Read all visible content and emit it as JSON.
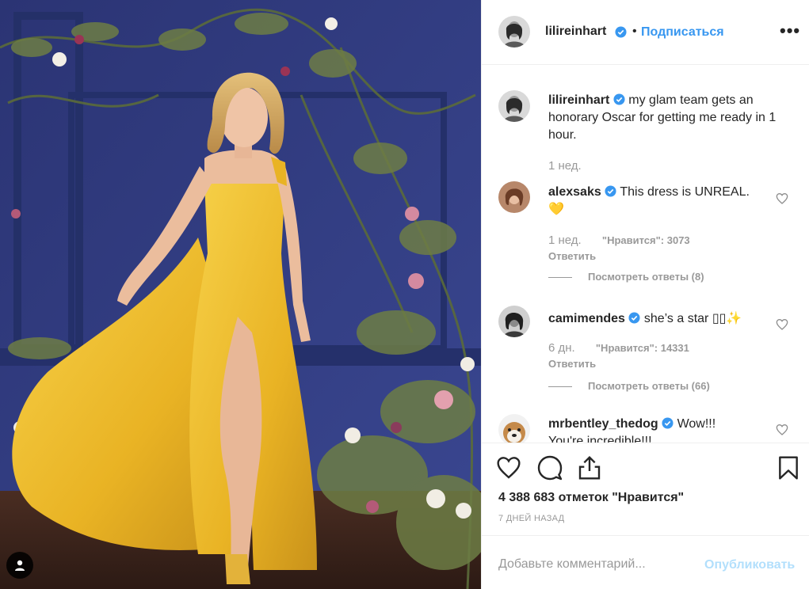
{
  "post": {
    "author": "lilireinhart",
    "follow_label": "Подписаться",
    "dot": "•",
    "more_label": "•••",
    "caption": {
      "username": "lilireinhart",
      "text": "my glam team gets an honorary Oscar for getting me ready in 1 hour.",
      "time": "1 нед."
    },
    "comments": [
      {
        "username": "alexsaks",
        "text": "This dress is UNREAL.",
        "emoji": "💛",
        "time": "1 нед.",
        "likes": "\"Нравится\": 3073",
        "reply_label": "Ответить",
        "view_replies": "Посмотреть ответы (8)"
      },
      {
        "username": "camimendes",
        "text": "she’s a star ▯▯✨",
        "time": "6 дн.",
        "likes": "\"Нравится\": 14331",
        "reply_label": "Ответить",
        "view_replies": "Посмотреть ответы (66)"
      },
      {
        "username": "mrbentley_thedog",
        "text": "Wow!!!",
        "text_line2": "You're incredible!!!"
      }
    ],
    "like_count": "4 388 683 отметок \"Нравится\"",
    "time_ago": "7 ДНЕЙ НАЗАД",
    "add_comment_placeholder": "Добавьте комментарий...",
    "publish_label": "Опубликовать"
  },
  "icons": {
    "verified": "verified-badge-icon",
    "heart": "heart-icon",
    "comment": "comment-icon",
    "share": "share-icon",
    "bookmark": "bookmark-icon",
    "user_tag": "user-tag-icon"
  },
  "colors": {
    "link_blue": "#3897f0",
    "muted": "#999999",
    "publish_disabled": "#b2dffc",
    "backdrop": "#2f3a78",
    "dress": "#f2c12e"
  }
}
